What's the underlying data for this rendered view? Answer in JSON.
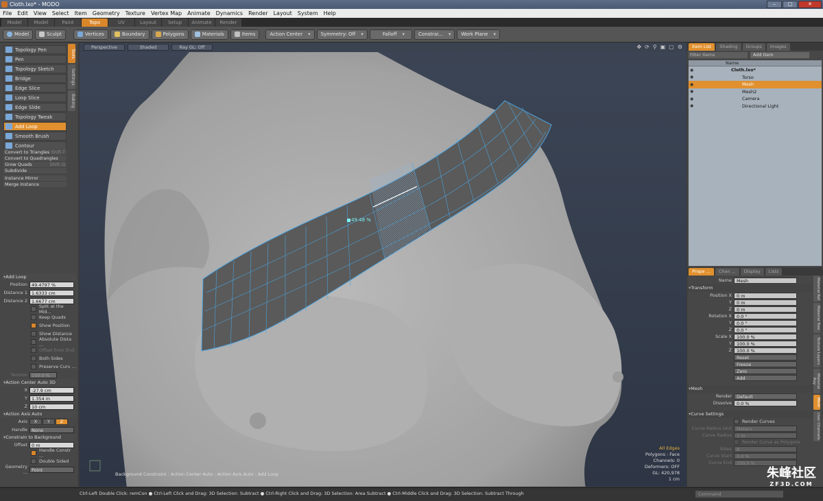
{
  "window": {
    "title": "Cloth.lxo* - MODO",
    "controls": [
      "‒",
      "□",
      "✕"
    ]
  },
  "menu": [
    "File",
    "Edit",
    "View",
    "Select",
    "Item",
    "Geometry",
    "Texture",
    "Vertex Map",
    "Animate",
    "Dynamics",
    "Render",
    "Layout",
    "System",
    "Help"
  ],
  "layout_tabs": [
    "Model",
    "Model Quad",
    "Paint",
    "Topo",
    "UV",
    "Layout",
    "Setup",
    "Animate",
    "Render"
  ],
  "active_layout_tab": "Topo",
  "toolbar": {
    "model": "Model",
    "sculpt": "Sculpt",
    "vertices": "Vertices",
    "boundary": "Boundary",
    "polygons": "Polygons",
    "materials": "Materials",
    "items": "Items",
    "action_center": "Action Center",
    "symmetry": "Symmetry: Off",
    "falloff": "Falloff",
    "constrain": "Constrai...",
    "work_plane": "Work Plane"
  },
  "tools": [
    {
      "label": "Topology Pen",
      "active": false
    },
    {
      "label": "Pen",
      "active": false
    },
    {
      "label": "Topology Sketch",
      "active": false
    },
    {
      "label": "Bridge",
      "active": false
    },
    {
      "label": "Edge Slice",
      "active": false
    },
    {
      "label": "Loop Slice",
      "active": false
    },
    {
      "label": "Edge Slide",
      "active": false
    },
    {
      "label": "Topology Tweak",
      "active": false
    },
    {
      "label": "Add Loop",
      "active": true
    },
    {
      "label": "Smooth Brush",
      "active": false
    },
    {
      "label": "Contour",
      "active": false
    }
  ],
  "tool_vtabs": [
    "Tools",
    "Settings",
    "Baking"
  ],
  "actions": [
    {
      "label": "Convert to Triangles",
      "shortcut": "Shift-T"
    },
    {
      "label": "Convert to Quadrangles",
      "shortcut": ""
    },
    {
      "label": "Grow Quads",
      "shortcut": "Shift-Q"
    },
    {
      "label": "Subdivide",
      "shortcut": ""
    },
    {
      "label": "Instance Mirror",
      "shortcut": ""
    },
    {
      "label": "Merge Instance",
      "shortcut": ""
    }
  ],
  "add_loop": {
    "title": "Add Loop",
    "position_label": "Position",
    "position": "49.4797 %",
    "distance1_label": "Distance 1",
    "distance1": "1.6333 cm",
    "distance2_label": "Distance 2",
    "distance2": "1.6677 cm",
    "checks": [
      {
        "label": "Split at the Mid...",
        "on": false,
        "disabled": false
      },
      {
        "label": "Keep Quads",
        "on": false,
        "disabled": false
      },
      {
        "label": "Show Position",
        "on": true,
        "disabled": false
      },
      {
        "label": "Show Distance",
        "on": false,
        "disabled": false
      },
      {
        "label": "Absolute Dista ...",
        "on": false,
        "disabled": false
      },
      {
        "label": "Offset from End",
        "on": false,
        "disabled": true
      },
      {
        "label": "Both Sides",
        "on": false,
        "disabled": false
      },
      {
        "label": "Preserve Curv ...",
        "on": false,
        "disabled": false
      }
    ],
    "tension_label": "Tension",
    "tension": "100.0 %"
  },
  "action_center": {
    "title": "Action Center Auto 3D",
    "x": "-27.9 cm",
    "y": "1.354 m",
    "z": "10 cm"
  },
  "action_axis": {
    "title": "Action Axis Auto",
    "axis_label": "Axis",
    "axes": [
      "X",
      "Y",
      "Z"
    ],
    "active_axis": "Z",
    "handle_label": "Handle",
    "handle": "None"
  },
  "constrain": {
    "title": "Constrain to Background",
    "offset_label": "Offset",
    "offset": "0 m",
    "handle_constr": "Handle Constr ...",
    "double_sided": "Double Sided",
    "geometry_label": "Geometry ...",
    "geometry": "Point"
  },
  "viewport": {
    "perspective": "Perspective",
    "shaded": "Shaded",
    "raygl": "Ray GL: Off",
    "handle_value": "49.48 %",
    "breadcrumb": "Background Constraint  : Action Center Auto : Action Axis Auto : Add Loop",
    "status": {
      "mode": "All Edges",
      "polygons": "Polygons : Face",
      "channels": "Channels: 0",
      "deformers": "Deformers: OFF",
      "gl": "GL: 420,978",
      "unit": "1 cm"
    }
  },
  "right_tabs": [
    "Item List",
    "Shading",
    "Groups",
    "Images"
  ],
  "item_filter": "Filter Items",
  "add_item": "Add Item",
  "name_col": "Name",
  "items": [
    {
      "name": "Cloth.lxo*",
      "indent": 0,
      "selected": false,
      "bold": true
    },
    {
      "name": "Torso",
      "indent": 1,
      "selected": false,
      "bold": false
    },
    {
      "name": "Mesh",
      "indent": 1,
      "selected": true,
      "bold": false
    },
    {
      "name": "Mesh2",
      "indent": 1,
      "selected": false,
      "bold": false
    },
    {
      "name": "Camera",
      "indent": 1,
      "selected": false,
      "bold": false
    },
    {
      "name": "Directional Light",
      "indent": 1,
      "selected": false,
      "bold": false
    }
  ],
  "prop_tabs": [
    "Prope ...",
    "Chan ...",
    "Display",
    "Lists"
  ],
  "props": {
    "name_label": "Name",
    "name": "Mesh",
    "transform": "Transform",
    "position": [
      "0 m",
      "0 m",
      "0 m"
    ],
    "rotation": [
      "0.0 °",
      "0.0 °",
      "0.0 °"
    ],
    "scale": [
      "100.0 %",
      "100.0 %",
      "100.0 %"
    ],
    "position_label": "Position X",
    "rotation_label": "Rotation X",
    "scale_label": "Scale X",
    "buttons": [
      "Reset",
      "Freeze",
      "Zero",
      "Add"
    ],
    "mesh": "Mesh",
    "render_label": "Render",
    "render": "Default",
    "dissolve_label": "Dissolve",
    "dissolve": "0.0 %",
    "curve_settings": "Curve Settings",
    "render_curves": "Render Curves",
    "curve_radius_unit_label": "Curve Radius Unit",
    "curve_radius_unit": "Meters",
    "curve_radius_label": "Curve Radius",
    "curve_radius": "1 m",
    "render_poly": "Render Curve as Polygons",
    "sides_label": "Sides",
    "sides": "8",
    "curve_start_label": "Curve Start",
    "curve_start": "0.0 %",
    "curve_end_label": "Curve End",
    "curve_end": "100.0 %"
  },
  "prop_vtabs": [
    {
      "label": "Material Ref",
      "active": false
    },
    {
      "label": "Material Tree",
      "active": false
    },
    {
      "label": "Texture Layers",
      "active": false
    },
    {
      "label": "Material Ray",
      "active": false
    },
    {
      "label": "Mesh",
      "active": true
    },
    {
      "label": "User Channels",
      "active": false
    }
  ],
  "statusbar": "Ctrl-Left Double Click: remCon ● Ctrl-Left Click and Drag: 3D Selection: Subtract ● Ctrl-Right Click and Drag: 3D Selection: Area Subtract ● Ctrl-Middle Click and Drag: 3D Selection: Subtract Through",
  "command": "Command",
  "watermark": {
    "main": "朱峰社区",
    "sub": "ZF3D.COM"
  },
  "colors": {
    "accent": "#e0902e",
    "mesh_lines": "#4aa3e0",
    "skin": "#a7a7a7"
  }
}
